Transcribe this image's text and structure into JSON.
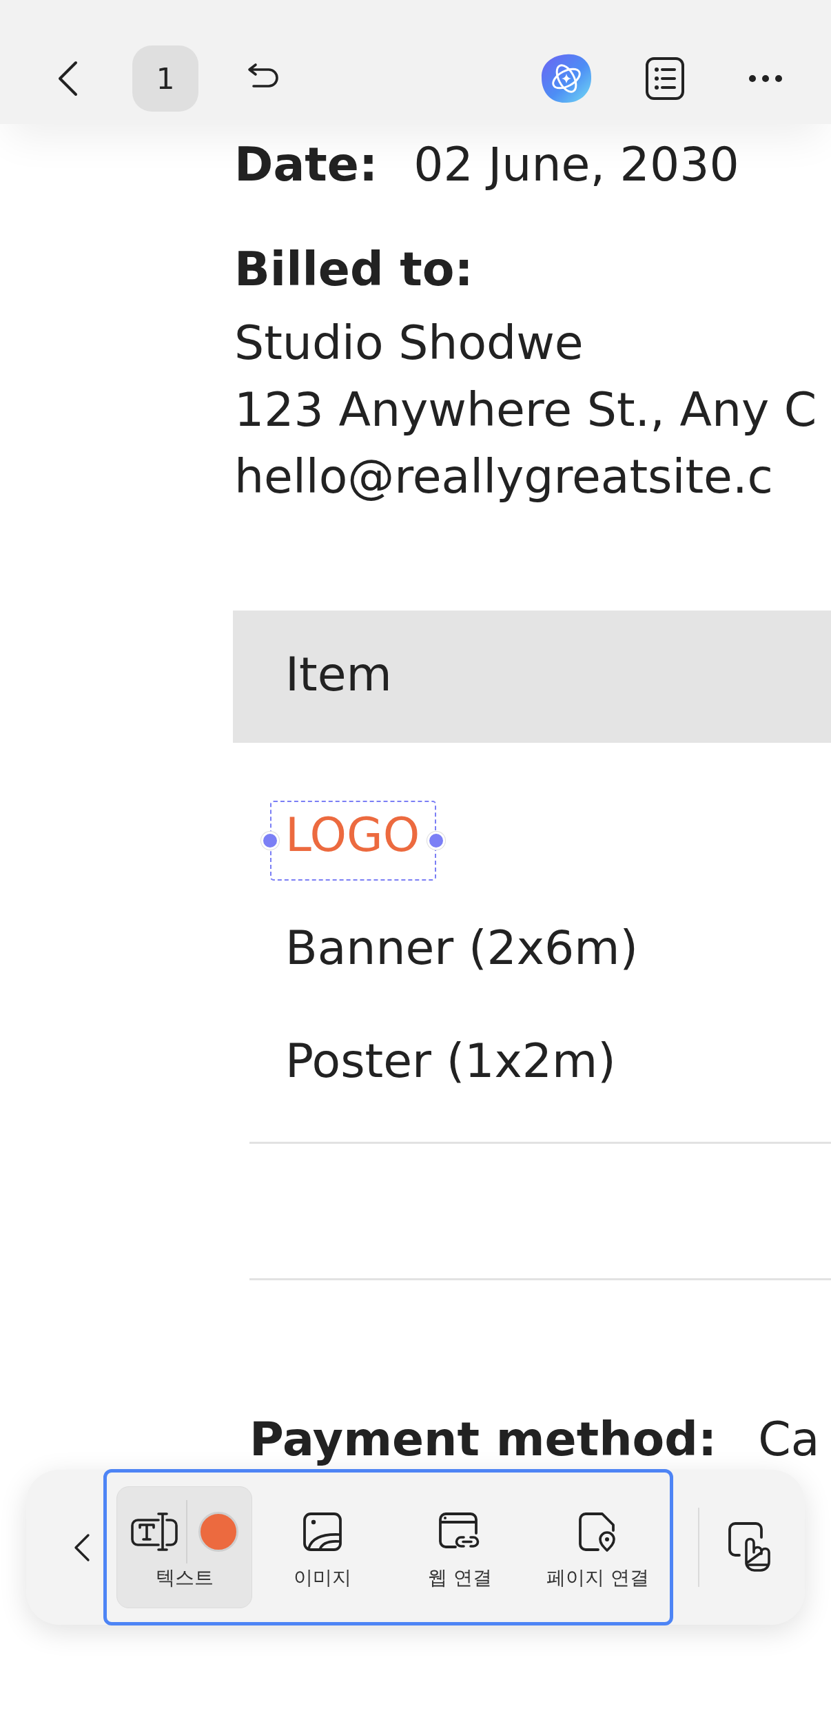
{
  "top_bar": {
    "page_number": "1"
  },
  "document": {
    "date": {
      "label": "Date:",
      "value": "02 June, 2030"
    },
    "billed_to": {
      "label": "Billed to:",
      "lines": [
        "Studio Shodwe",
        "123 Anywhere St., Any C",
        "hello@reallygreatsite.c"
      ]
    },
    "table": {
      "columns": [
        "Item"
      ],
      "rows": [
        {
          "item": "LOGO",
          "color": "#ec6a3f",
          "selected": true
        },
        {
          "item": "Banner (2x6m)",
          "color": "#222222",
          "selected": false
        },
        {
          "item": "Poster (1x2m)",
          "color": "#222222",
          "selected": false
        }
      ]
    },
    "payment": {
      "label": "Payment method:",
      "value": "Ca"
    }
  },
  "toolbar": {
    "tools": [
      {
        "kind": "text",
        "label": "텍스트",
        "selected": true,
        "color": "#ec6a3f"
      },
      {
        "kind": "image",
        "label": "이미지",
        "selected": false
      },
      {
        "kind": "web_link",
        "label": "웹 연결",
        "selected": false
      },
      {
        "kind": "page_link",
        "label": "페이지 연결",
        "selected": false
      }
    ]
  }
}
